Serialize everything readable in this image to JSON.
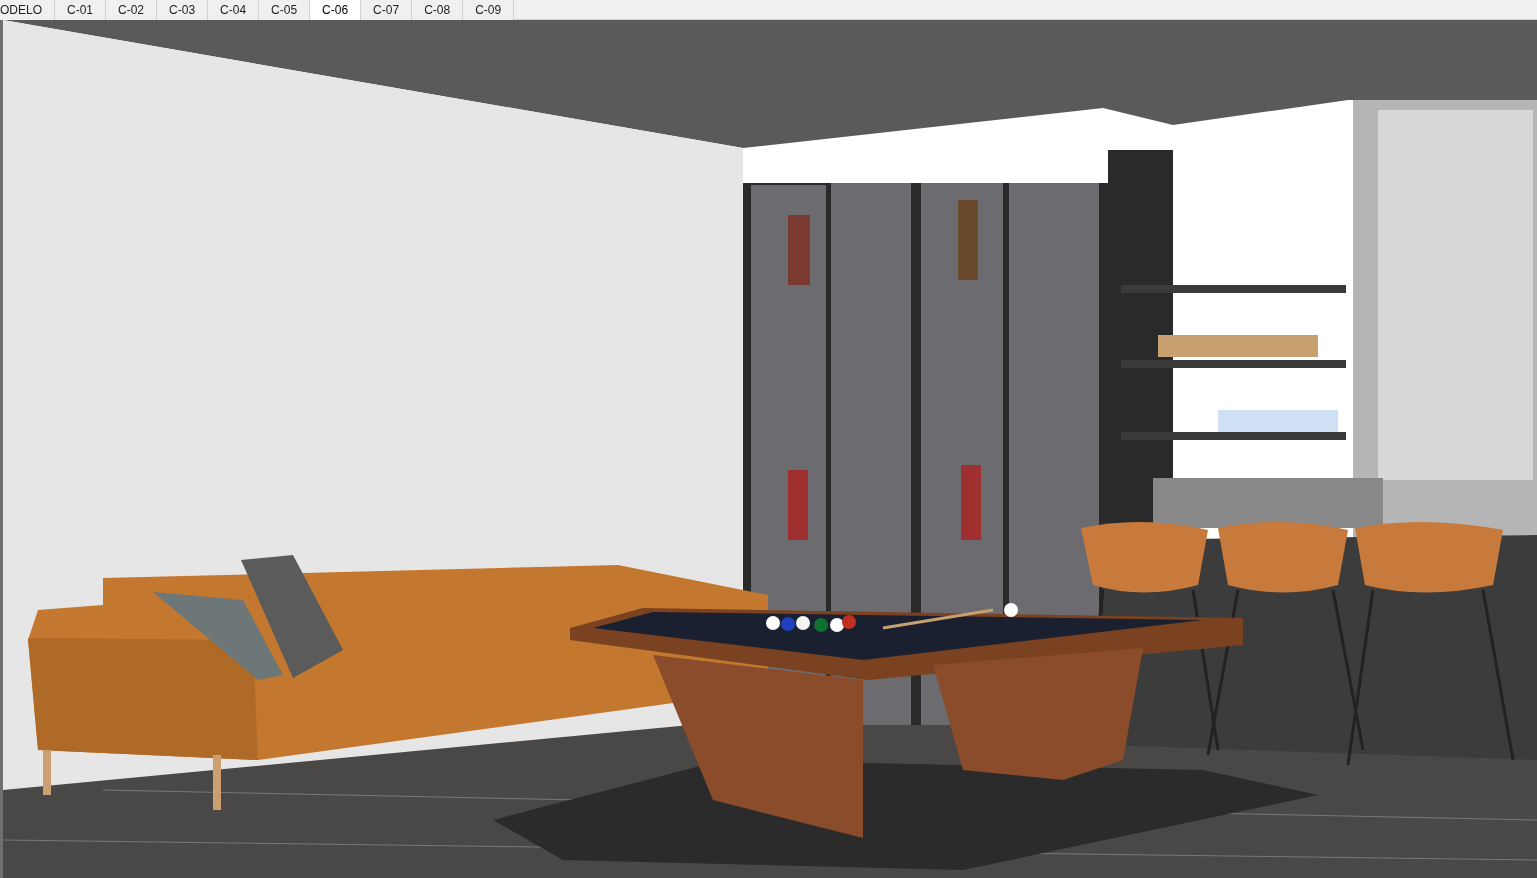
{
  "scene_tabs": [
    {
      "label": "ODELO",
      "selected": false
    },
    {
      "label": "C-01",
      "selected": false
    },
    {
      "label": "C-02",
      "selected": false
    },
    {
      "label": "C-03",
      "selected": false
    },
    {
      "label": "C-04",
      "selected": false
    },
    {
      "label": "C-05",
      "selected": false
    },
    {
      "label": "C-06",
      "selected": true
    },
    {
      "label": "C-07",
      "selected": false
    },
    {
      "label": "C-08",
      "selected": false
    },
    {
      "label": "C-09",
      "selected": false
    }
  ]
}
